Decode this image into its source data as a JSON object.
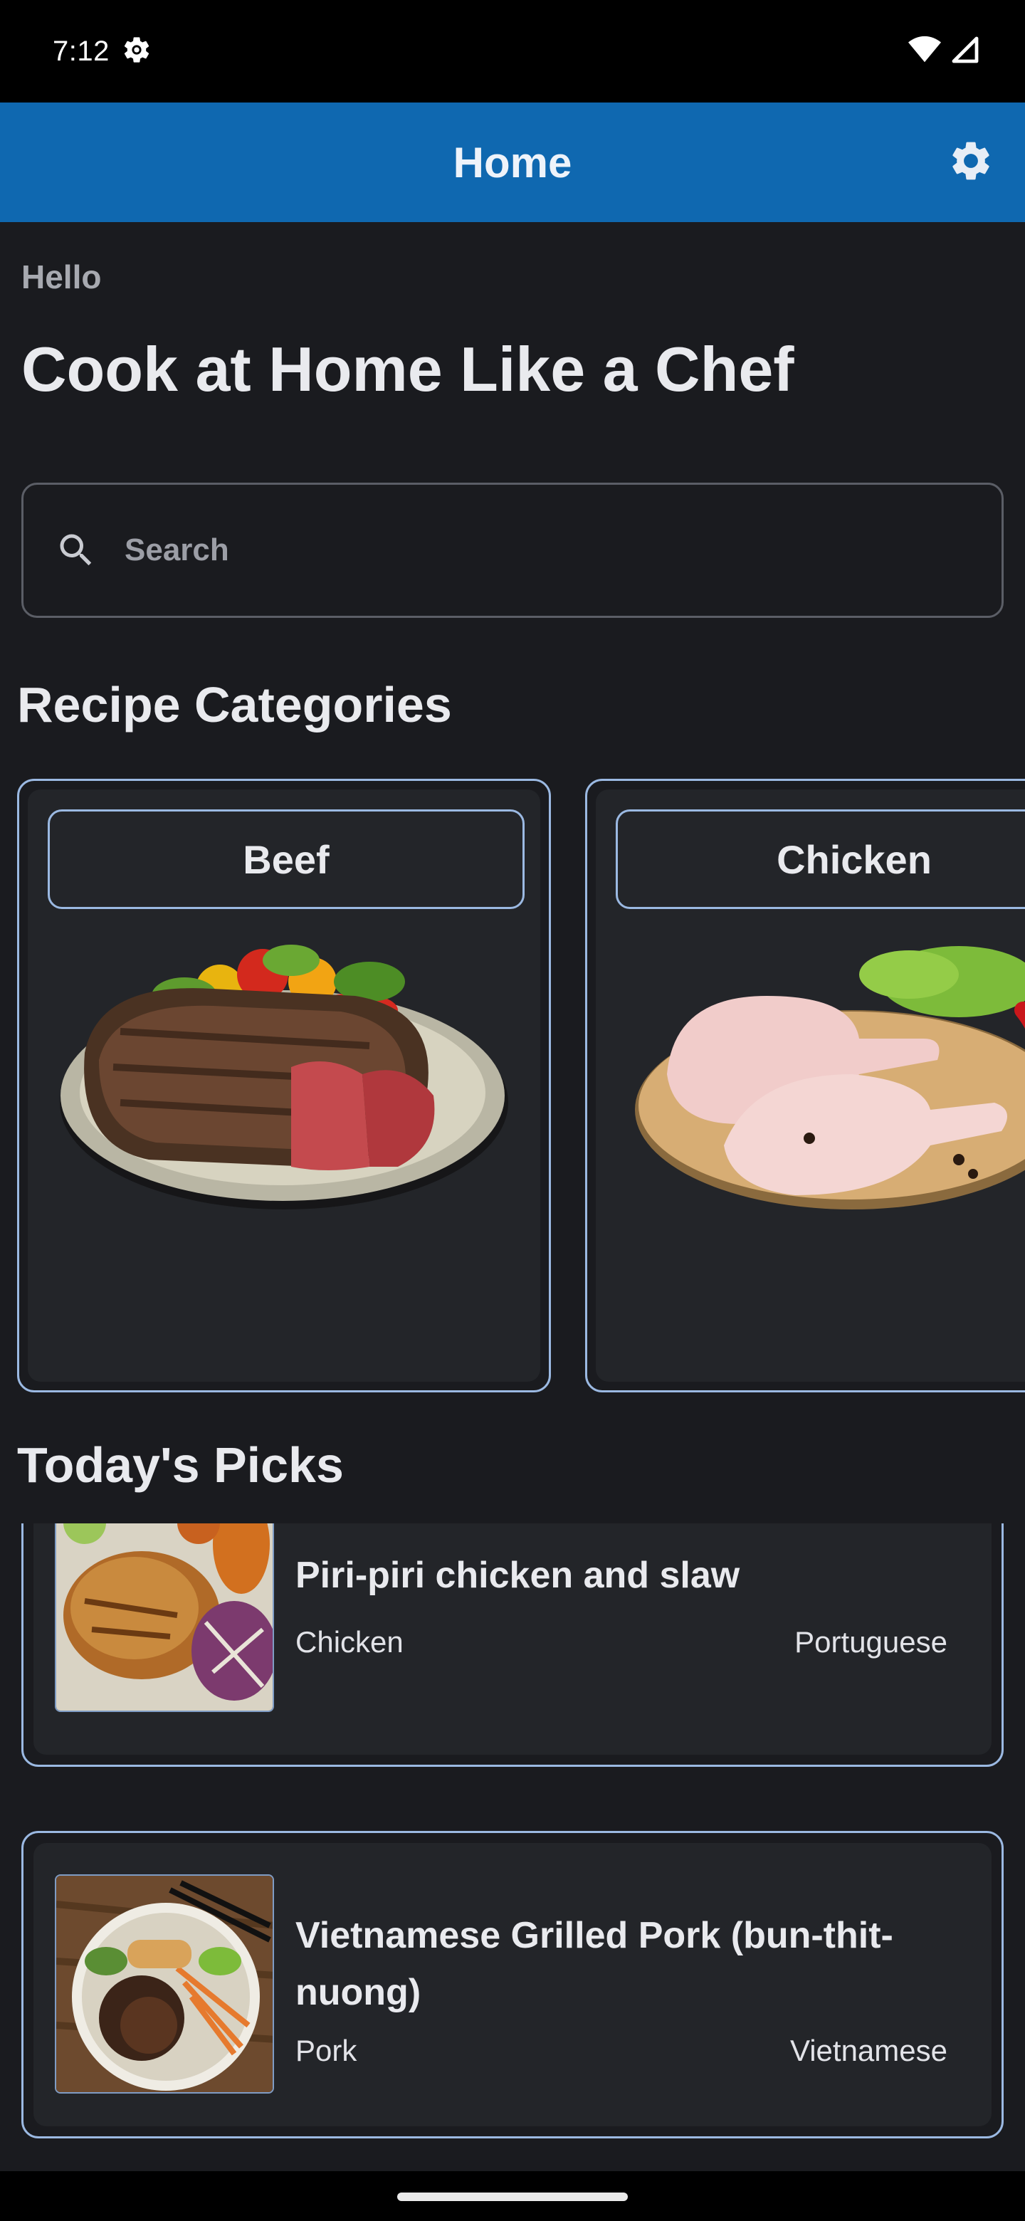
{
  "status_bar": {
    "time": "7:12"
  },
  "app_bar": {
    "title": "Home"
  },
  "greeting": "Hello",
  "headline": "Cook at Home Like a Chef",
  "search": {
    "placeholder": "Search",
    "value": ""
  },
  "categories_section": {
    "title": "Recipe Categories",
    "items": [
      {
        "label": "Beef"
      },
      {
        "label": "Chicken"
      }
    ]
  },
  "picks_section": {
    "title": "Today's Picks",
    "items": [
      {
        "name": "Piri-piri chicken and slaw",
        "category": "Chicken",
        "area": "Portuguese"
      },
      {
        "name": "Vietnamese Grilled Pork (bun-thit-nuong)",
        "category": "Pork",
        "area": "Vietnamese"
      }
    ]
  },
  "colors": {
    "app_bar": "#0f68b0",
    "background": "#1a1b1f",
    "card_border": "#9bb9e2",
    "card_fill": "#232529"
  }
}
